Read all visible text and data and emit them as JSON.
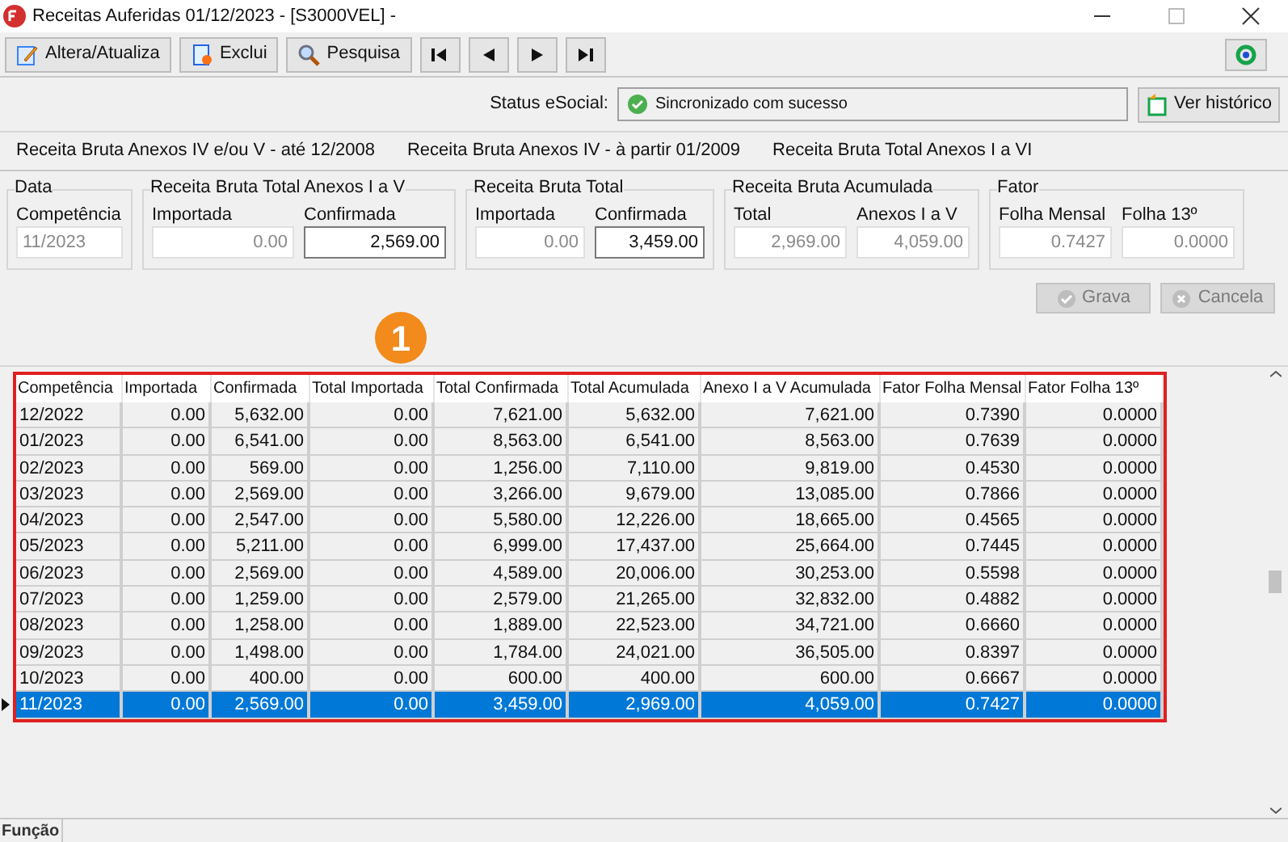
{
  "window": {
    "title": "Receitas Auferidas  01/12/2023 - [S3000VEL] -"
  },
  "toolbar": [
    {
      "kind": "edit",
      "label": "Altera/Atualiza"
    },
    {
      "kind": "delete",
      "label": "Exclui"
    },
    {
      "kind": "search",
      "label": "Pesquisa"
    },
    {
      "kind": "first"
    },
    {
      "kind": "prev"
    },
    {
      "kind": "next"
    },
    {
      "kind": "last"
    }
  ],
  "status_esocial": {
    "label": "Status eSocial:",
    "value": "Sincronizado com sucesso",
    "history_button": "Ver histórico"
  },
  "tabs": [
    {
      "label": "Receita Bruta Anexos IV e/ou V - até 12/2008"
    },
    {
      "label": "Receita Bruta Anexos IV - à partir 01/2009"
    },
    {
      "label": "Receita Bruta Total Anexos I a VI"
    }
  ],
  "groups": [
    {
      "title": "Data",
      "fields": [
        {
          "label": "Competência",
          "value": "11/2023",
          "editable": false
        }
      ]
    },
    {
      "title": "Receita Bruta Total Anexos I a V",
      "fields": [
        {
          "label": "Importada",
          "value": "0.00",
          "editable": false
        },
        {
          "label": "Confirmada",
          "value": "2,569.00",
          "editable": true
        }
      ]
    },
    {
      "title": "Receita Bruta Total",
      "fields": [
        {
          "label": "Importada",
          "value": "0.00",
          "editable": false
        },
        {
          "label": "Confirmada",
          "value": "3,459.00",
          "editable": true
        }
      ]
    },
    {
      "title": "Receita Bruta Acumulada",
      "fields": [
        {
          "label": "Total",
          "value": "2,969.00",
          "editable": false
        },
        {
          "label": "Anexos I a V",
          "value": "4,059.00",
          "editable": false
        }
      ]
    },
    {
      "title": "Fator",
      "fields": [
        {
          "label": "Folha Mensal",
          "value": "0.7427",
          "editable": false
        },
        {
          "label": "Folha 13º",
          "value": "0.0000",
          "editable": false
        }
      ]
    }
  ],
  "actions": [
    {
      "kind": "save",
      "label": "Grava",
      "disabled": true
    },
    {
      "kind": "cancel",
      "label": "Cancela",
      "disabled": true
    }
  ],
  "callout": "1",
  "table": {
    "columns": [
      "Competência",
      "Importada",
      "Confirmada",
      "Total Importada",
      "Total Confirmada",
      "Total Acumulada",
      "Anexo I a V Acumulada",
      "Fator Folha Mensal",
      "Fator Folha 13º"
    ],
    "rows": [
      {
        "cells": [
          "12/2022",
          "0.00",
          "5,632.00",
          "0.00",
          "7,621.00",
          "5,632.00",
          "7,621.00",
          "0.7390",
          "0.0000"
        ],
        "selected": false
      },
      {
        "cells": [
          "01/2023",
          "0.00",
          "6,541.00",
          "0.00",
          "8,563.00",
          "6,541.00",
          "8,563.00",
          "0.7639",
          "0.0000"
        ],
        "selected": false
      },
      {
        "cells": [
          "02/2023",
          "0.00",
          "569.00",
          "0.00",
          "1,256.00",
          "7,110.00",
          "9,819.00",
          "0.4530",
          "0.0000"
        ],
        "selected": false
      },
      {
        "cells": [
          "03/2023",
          "0.00",
          "2,569.00",
          "0.00",
          "3,266.00",
          "9,679.00",
          "13,085.00",
          "0.7866",
          "0.0000"
        ],
        "selected": false
      },
      {
        "cells": [
          "04/2023",
          "0.00",
          "2,547.00",
          "0.00",
          "5,580.00",
          "12,226.00",
          "18,665.00",
          "0.4565",
          "0.0000"
        ],
        "selected": false
      },
      {
        "cells": [
          "05/2023",
          "0.00",
          "5,211.00",
          "0.00",
          "6,999.00",
          "17,437.00",
          "25,664.00",
          "0.7445",
          "0.0000"
        ],
        "selected": false
      },
      {
        "cells": [
          "06/2023",
          "0.00",
          "2,569.00",
          "0.00",
          "4,589.00",
          "20,006.00",
          "30,253.00",
          "0.5598",
          "0.0000"
        ],
        "selected": false
      },
      {
        "cells": [
          "07/2023",
          "0.00",
          "1,259.00",
          "0.00",
          "2,579.00",
          "21,265.00",
          "32,832.00",
          "0.4882",
          "0.0000"
        ],
        "selected": false
      },
      {
        "cells": [
          "08/2023",
          "0.00",
          "1,258.00",
          "0.00",
          "1,889.00",
          "22,523.00",
          "34,721.00",
          "0.6660",
          "0.0000"
        ],
        "selected": false
      },
      {
        "cells": [
          "09/2023",
          "0.00",
          "1,498.00",
          "0.00",
          "1,784.00",
          "24,021.00",
          "36,505.00",
          "0.8397",
          "0.0000"
        ],
        "selected": false
      },
      {
        "cells": [
          "10/2023",
          "0.00",
          "400.00",
          "0.00",
          "600.00",
          "400.00",
          "600.00",
          "0.6667",
          "0.0000"
        ],
        "selected": false
      },
      {
        "cells": [
          "11/2023",
          "0.00",
          "2,569.00",
          "0.00",
          "3,459.00",
          "2,969.00",
          "4,059.00",
          "0.7427",
          "0.0000"
        ],
        "selected": true
      }
    ]
  },
  "status_bar": {
    "label": "Função"
  }
}
